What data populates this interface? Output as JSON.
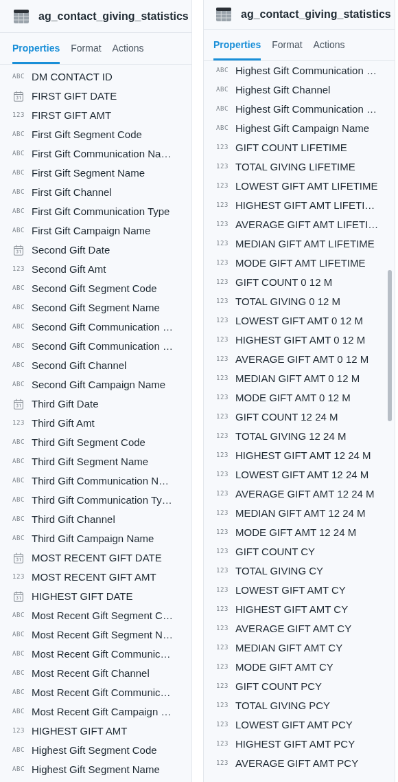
{
  "panels": [
    {
      "title": "ag_contact_giving_statistics",
      "tabs": [
        {
          "label": "Properties",
          "selected": true
        },
        {
          "label": "Format",
          "selected": false
        },
        {
          "label": "Actions",
          "selected": false
        }
      ],
      "scrollbar": false,
      "fields": [
        {
          "kind": "text",
          "badge": "ABC",
          "label": "DM CONTACT ID"
        },
        {
          "kind": "date",
          "label": "FIRST GIFT DATE"
        },
        {
          "kind": "number",
          "badge": "123",
          "label": "FIRST GIFT AMT"
        },
        {
          "kind": "text",
          "badge": "ABC",
          "label": "First Gift Segment Code"
        },
        {
          "kind": "text",
          "badge": "ABC",
          "label": "First Gift Communication Na…"
        },
        {
          "kind": "text",
          "badge": "ABC",
          "label": "First Gift Segment Name"
        },
        {
          "kind": "text",
          "badge": "ABC",
          "label": "First Gift Channel"
        },
        {
          "kind": "text",
          "badge": "ABC",
          "label": "First Gift Communication Type"
        },
        {
          "kind": "text",
          "badge": "ABC",
          "label": "First Gift Campaign Name"
        },
        {
          "kind": "date",
          "label": "Second Gift Date"
        },
        {
          "kind": "number",
          "badge": "123",
          "label": "Second Gift Amt"
        },
        {
          "kind": "text",
          "badge": "ABC",
          "label": "Second Gift Segment Code"
        },
        {
          "kind": "text",
          "badge": "ABC",
          "label": "Second Gift Segment Name"
        },
        {
          "kind": "text",
          "badge": "ABC",
          "label": "Second Gift Communication …"
        },
        {
          "kind": "text",
          "badge": "ABC",
          "label": "Second Gift Communication …"
        },
        {
          "kind": "text",
          "badge": "ABC",
          "label": "Second Gift Channel"
        },
        {
          "kind": "text",
          "badge": "ABC",
          "label": "Second Gift Campaign Name"
        },
        {
          "kind": "date",
          "label": "Third Gift Date"
        },
        {
          "kind": "number",
          "badge": "123",
          "label": "Third Gift Amt"
        },
        {
          "kind": "text",
          "badge": "ABC",
          "label": "Third Gift Segment Code"
        },
        {
          "kind": "text",
          "badge": "ABC",
          "label": "Third Gift Segment Name"
        },
        {
          "kind": "text",
          "badge": "ABC",
          "label": "Third Gift Communication N…"
        },
        {
          "kind": "text",
          "badge": "ABC",
          "label": "Third Gift Communication Ty…"
        },
        {
          "kind": "text",
          "badge": "ABC",
          "label": "Third Gift Channel"
        },
        {
          "kind": "text",
          "badge": "ABC",
          "label": "Third Gift Campaign Name"
        },
        {
          "kind": "date",
          "label": "MOST RECENT GIFT DATE"
        },
        {
          "kind": "number",
          "badge": "123",
          "label": "MOST RECENT GIFT AMT"
        },
        {
          "kind": "date",
          "label": "HIGHEST GIFT DATE"
        },
        {
          "kind": "text",
          "badge": "ABC",
          "label": "Most Recent Gift Segment C…"
        },
        {
          "kind": "text",
          "badge": "ABC",
          "label": "Most Recent Gift Segment N…"
        },
        {
          "kind": "text",
          "badge": "ABC",
          "label": "Most Recent Gift Communic…"
        },
        {
          "kind": "text",
          "badge": "ABC",
          "label": "Most Recent Gift Channel"
        },
        {
          "kind": "text",
          "badge": "ABC",
          "label": "Most Recent Gift Communic…"
        },
        {
          "kind": "text",
          "badge": "ABC",
          "label": "Most Recent Gift Campaign …"
        },
        {
          "kind": "number",
          "badge": "123",
          "label": "HIGHEST GIFT AMT"
        },
        {
          "kind": "text",
          "badge": "ABC",
          "label": "Highest Gift Segment Code"
        },
        {
          "kind": "text",
          "badge": "ABC",
          "label": "Highest Gift Segment Name"
        }
      ]
    },
    {
      "title": "ag_contact_giving_statistics",
      "tabs": [
        {
          "label": "Properties",
          "selected": true
        },
        {
          "label": "Format",
          "selected": false
        },
        {
          "label": "Actions",
          "selected": false
        }
      ],
      "scrollbar": true,
      "fields": [
        {
          "kind": "text",
          "badge": "ABC",
          "label": "Highest Gift Communication …"
        },
        {
          "kind": "text",
          "badge": "ABC",
          "label": "Highest Gift Channel"
        },
        {
          "kind": "text",
          "badge": "ABC",
          "label": "Highest Gift Communication …"
        },
        {
          "kind": "text",
          "badge": "ABC",
          "label": "Highest Gift Campaign Name"
        },
        {
          "kind": "number",
          "badge": "123",
          "label": "GIFT COUNT LIFETIME"
        },
        {
          "kind": "number",
          "badge": "123",
          "label": "TOTAL GIVING LIFETIME"
        },
        {
          "kind": "number",
          "badge": "123",
          "label": "LOWEST GIFT AMT LIFETIME"
        },
        {
          "kind": "number",
          "badge": "123",
          "label": "HIGHEST GIFT AMT LIFETI…"
        },
        {
          "kind": "number",
          "badge": "123",
          "label": "AVERAGE GIFT AMT LIFETI…"
        },
        {
          "kind": "number",
          "badge": "123",
          "label": "MEDIAN GIFT AMT LIFETIME"
        },
        {
          "kind": "number",
          "badge": "123",
          "label": "MODE GIFT AMT LIFETIME"
        },
        {
          "kind": "number",
          "badge": "123",
          "label": "GIFT COUNT 0 12 M"
        },
        {
          "kind": "number",
          "badge": "123",
          "label": "TOTAL GIVING 0 12 M"
        },
        {
          "kind": "number",
          "badge": "123",
          "label": "LOWEST GIFT AMT 0 12 M"
        },
        {
          "kind": "number",
          "badge": "123",
          "label": "HIGHEST GIFT AMT 0 12 M"
        },
        {
          "kind": "number",
          "badge": "123",
          "label": "AVERAGE GIFT AMT 0 12 M"
        },
        {
          "kind": "number",
          "badge": "123",
          "label": "MEDIAN GIFT AMT 0 12 M"
        },
        {
          "kind": "number",
          "badge": "123",
          "label": "MODE GIFT AMT 0 12 M"
        },
        {
          "kind": "number",
          "badge": "123",
          "label": "GIFT COUNT 12 24 M"
        },
        {
          "kind": "number",
          "badge": "123",
          "label": "TOTAL GIVING 12 24 M"
        },
        {
          "kind": "number",
          "badge": "123",
          "label": "HIGHEST GIFT AMT 12 24 M"
        },
        {
          "kind": "number",
          "badge": "123",
          "label": "LOWEST GIFT AMT 12 24 M"
        },
        {
          "kind": "number",
          "badge": "123",
          "label": "AVERAGE GIFT AMT 12 24 M"
        },
        {
          "kind": "number",
          "badge": "123",
          "label": "MEDIAN GIFT AMT 12 24 M"
        },
        {
          "kind": "number",
          "badge": "123",
          "label": "MODE GIFT AMT 12 24 M"
        },
        {
          "kind": "number",
          "badge": "123",
          "label": "GIFT COUNT CY"
        },
        {
          "kind": "number",
          "badge": "123",
          "label": "TOTAL GIVING CY"
        },
        {
          "kind": "number",
          "badge": "123",
          "label": "LOWEST GIFT AMT CY"
        },
        {
          "kind": "number",
          "badge": "123",
          "label": "HIGHEST GIFT AMT CY"
        },
        {
          "kind": "number",
          "badge": "123",
          "label": "AVERAGE GIFT AMT CY"
        },
        {
          "kind": "number",
          "badge": "123",
          "label": "MEDIAN GIFT AMT CY"
        },
        {
          "kind": "number",
          "badge": "123",
          "label": "MODE GIFT AMT CY"
        },
        {
          "kind": "number",
          "badge": "123",
          "label": "GIFT COUNT PCY"
        },
        {
          "kind": "number",
          "badge": "123",
          "label": "TOTAL GIVING PCY"
        },
        {
          "kind": "number",
          "badge": "123",
          "label": "LOWEST GIFT AMT PCY"
        },
        {
          "kind": "number",
          "badge": "123",
          "label": "HIGHEST GIFT AMT PCY"
        },
        {
          "kind": "number",
          "badge": "123",
          "label": "AVERAGE GIFT AMT PCY"
        }
      ]
    }
  ]
}
